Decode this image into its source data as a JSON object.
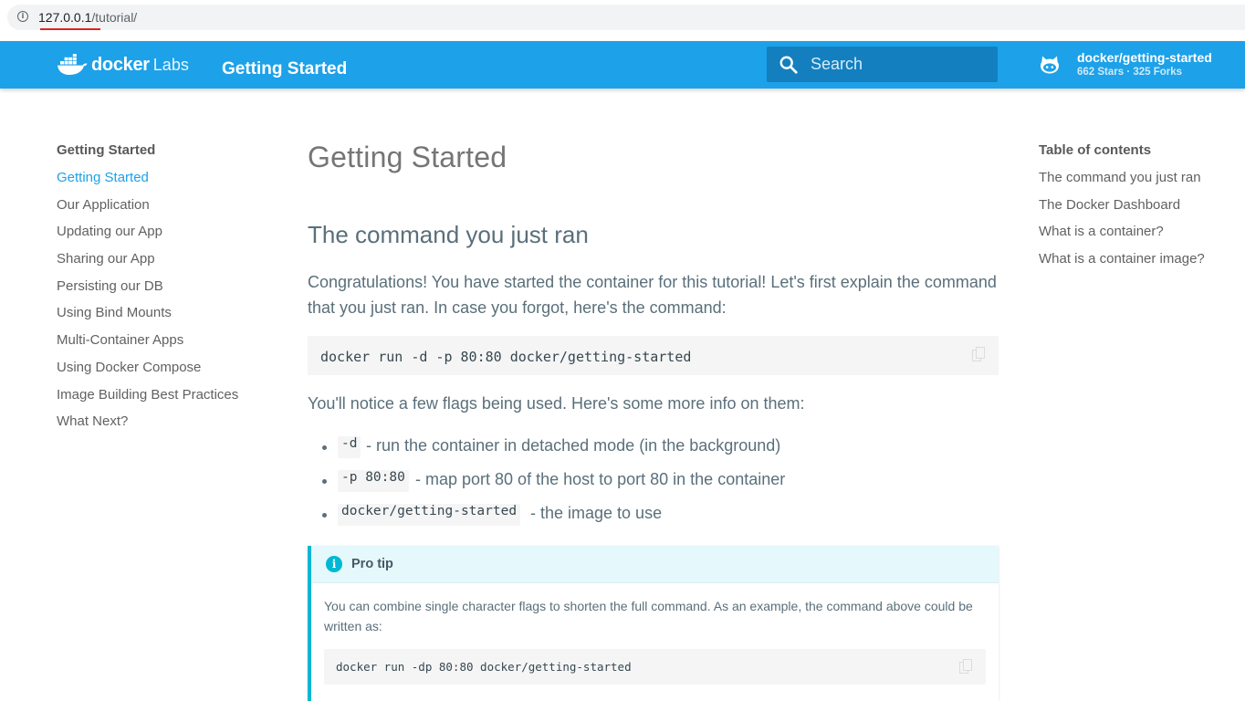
{
  "browser": {
    "url_host": "127.0.0.1",
    "url_path": "/tutorial/"
  },
  "header": {
    "logo_docker": "docker",
    "logo_labs": "Labs",
    "site_title": "Getting Started",
    "search_placeholder": "Search",
    "repo_name": "docker/getting-started",
    "repo_stats": "662 Stars · 325 Forks",
    "brand_color": "#1da1e9"
  },
  "sidebar": {
    "title": "Getting Started",
    "items": [
      {
        "label": "Getting Started",
        "active": true
      },
      {
        "label": "Our Application"
      },
      {
        "label": "Updating our App"
      },
      {
        "label": "Sharing our App"
      },
      {
        "label": "Persisting our DB"
      },
      {
        "label": "Using Bind Mounts"
      },
      {
        "label": "Multi-Container Apps"
      },
      {
        "label": "Using Docker Compose"
      },
      {
        "label": "Image Building Best Practices"
      },
      {
        "label": "What Next?"
      }
    ]
  },
  "toc": {
    "title": "Table of contents",
    "items": [
      {
        "label": "The command you just ran"
      },
      {
        "label": "The Docker Dashboard"
      },
      {
        "label": "What is a container?"
      },
      {
        "label": "What is a container image?"
      }
    ]
  },
  "main": {
    "page_title": "Getting Started",
    "section_title": "The command you just ran",
    "intro": "Congratulations! You have started the container for this tutorial! Let's first explain the command that you just ran. In case you forgot, here's the command:",
    "command": "docker run -d -p 80:80 docker/getting-started",
    "flags_intro": "You'll notice a few flags being used. Here's some more info on them:",
    "flags": [
      {
        "code": "-d",
        "desc": "- run the container in detached mode (in the background)"
      },
      {
        "code": "-p 80:80",
        "desc": "- map port 80 of the host to port 80 in the container"
      },
      {
        "code": "docker/getting-started",
        "desc": "- the image to use"
      }
    ],
    "tip": {
      "icon": "i",
      "title": "Pro tip",
      "body": "You can combine single character flags to shorten the full command. As an example, the command above could be written as:",
      "command": "docker run -dp 80:80 docker/getting-started"
    }
  }
}
